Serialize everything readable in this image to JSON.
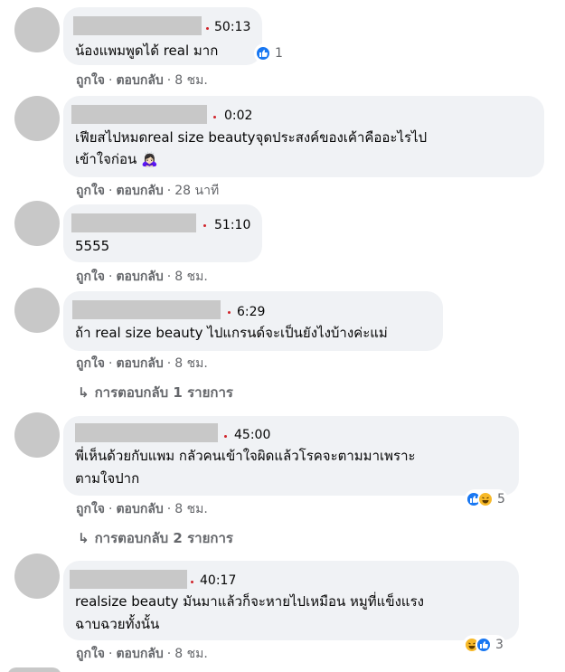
{
  "comments": [
    {
      "timestamp": "50:13",
      "text_lines": [
        "น้องแพมพูดได้ real มาก"
      ],
      "action_like": "ถูกใจ",
      "action_reply": "ตอบกลับ",
      "time": "8 ชม.",
      "reaction_count": "1",
      "reaction_icons": [
        "like-icon"
      ]
    },
    {
      "timestamp": "0:02",
      "text_lines": [
        "เฟียสไปหมดreal size beautyจุดประสงค์ของเค้าคืออะไรไป",
        "เข้าใจก่อน 🙇🏻‍♀️"
      ],
      "action_like": "ถูกใจ",
      "action_reply": "ตอบกลับ",
      "time": "28 นาที"
    },
    {
      "timestamp": "51:10",
      "text_lines": [
        "5555"
      ],
      "action_like": "ถูกใจ",
      "action_reply": "ตอบกลับ",
      "time": "8 ชม."
    },
    {
      "timestamp": "6:29",
      "text_lines": [
        "ถ้า real size beauty ไปแกรนด์จะเป็นยังไงบ้างค่ะแม่"
      ],
      "action_like": "ถูกใจ",
      "action_reply": "ตอบกลับ",
      "time": "8 ชม.",
      "replies_label": "การตอบกลับ 1 รายการ"
    },
    {
      "timestamp": "45:00",
      "text_lines": [
        "พี่เห็นด้วยกับแพม กลัวคนเข้าใจผิดแล้วโรคจะตามมาเพราะ",
        "ตามใจปาก"
      ],
      "action_like": "ถูกใจ",
      "action_reply": "ตอบกลับ",
      "time": "8 ชม.",
      "reaction_count": "5",
      "reaction_icons": [
        "like-icon",
        "haha-icon"
      ],
      "replies_label": "การตอบกลับ 2 รายการ"
    },
    {
      "timestamp": "40:17",
      "text_lines": [
        "realsize beauty มันมาแล้วก็จะหายไปเหมือน หมูที่แข็งแรง",
        "ฉาบฉวยทั้งนั้น"
      ],
      "action_like": "ถูกใจ",
      "action_reply": "ตอบกลับ",
      "time": "8 ชม.",
      "reaction_count": "3",
      "reaction_icons": [
        "haha-icon",
        "like-icon"
      ]
    }
  ],
  "colors": {
    "bubble": "#f0f2f5",
    "timestamp_dot": "#d0242b",
    "like": "#1877f2",
    "haha": "#f7b928",
    "meta": "#65676b"
  }
}
